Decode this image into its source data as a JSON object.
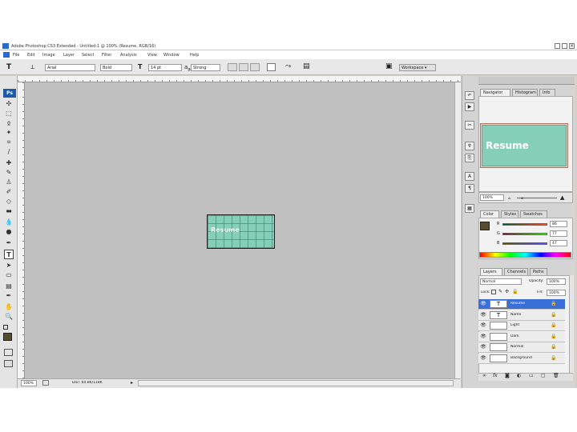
{
  "window": {
    "title": "Adobe Photoshop CS3 Extended - Untitled-1 @ 100% (Resume, RGB/16)",
    "ps_logo": "Ps"
  },
  "menubar": {
    "items": [
      "File",
      "Edit",
      "Image",
      "Layer",
      "Select",
      "Filter",
      "Analysis",
      "View",
      "Window",
      "Help"
    ]
  },
  "options": {
    "font_family": "Arial",
    "font_style": "Bold",
    "font_size": "14 pt",
    "antialias": "Strong",
    "workspace": "Workspace ▾"
  },
  "document": {
    "text": "Resume",
    "color": "#85cfb8"
  },
  "status": {
    "zoom": "100%",
    "doc_info": "Doc: 60.8K/118K"
  },
  "navigator": {
    "tabs": [
      "Navigator",
      "Histogram",
      "Info"
    ],
    "thumb_text": "Resume",
    "zoom": "100%"
  },
  "color_panel": {
    "tabs": [
      "Color",
      "Styles",
      "Swatches"
    ],
    "channels": [
      {
        "label": "R",
        "value": "86"
      },
      {
        "label": "G",
        "value": "77"
      },
      {
        "label": "B",
        "value": "47"
      }
    ],
    "foreground": "#564d2f"
  },
  "layers": {
    "tabs": [
      "Layers",
      "Channels",
      "Paths"
    ],
    "blend_mode": "Normal",
    "opacity_label": "Opacity:",
    "opacity": "100%",
    "lock_label": "Lock:",
    "fill_label": "Fill:",
    "fill": "100%",
    "rows": [
      {
        "name": "Resume",
        "type": "T",
        "selected": true
      },
      {
        "name": "Name",
        "type": "T",
        "selected": false
      },
      {
        "name": "Light",
        "type": "",
        "selected": false
      },
      {
        "name": "Dark",
        "type": "",
        "selected": false
      },
      {
        "name": "Normal",
        "type": "",
        "selected": false
      },
      {
        "name": "Background",
        "type": "",
        "selected": false
      }
    ]
  },
  "icons": {
    "tools": [
      "move-icon",
      "marquee-icon",
      "lasso-icon",
      "magic-wand-icon",
      "crop-icon",
      "slice-icon",
      "healing-brush-icon",
      "brush-icon",
      "clone-stamp-icon",
      "history-brush-icon",
      "eraser-icon",
      "gradient-icon",
      "blur-icon",
      "dodge-icon",
      "pen-icon",
      "type-icon",
      "path-select-icon",
      "shape-icon",
      "notes-icon",
      "eyedropper-icon",
      "hand-icon",
      "zoom-icon"
    ]
  }
}
